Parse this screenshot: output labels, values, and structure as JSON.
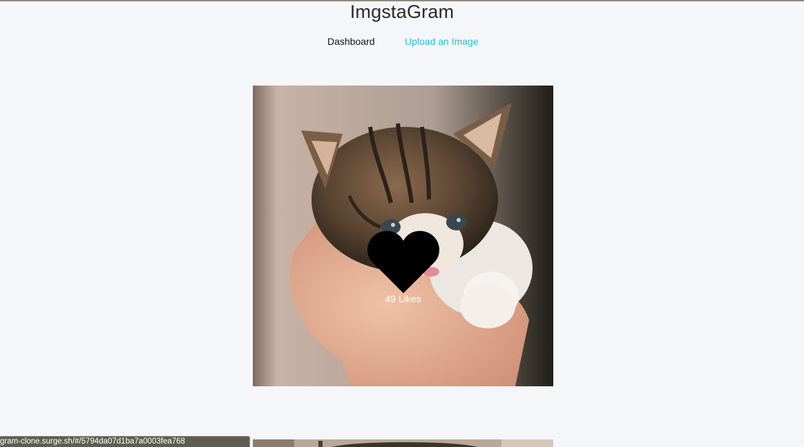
{
  "app": {
    "title": "ImgstaGram"
  },
  "nav": {
    "items": [
      {
        "label": "Dashboard",
        "active": true
      },
      {
        "label": "Upload an Image",
        "active": false
      }
    ],
    "accent_color": "#2bbdd1"
  },
  "feed": {
    "posts": [
      {
        "image_subject": "kitten held in a hand",
        "likes_label": "49 Likes",
        "likes": 49,
        "like_icon": "heart-icon"
      },
      {
        "image_subject": "next post image (partially visible)"
      }
    ]
  },
  "status_bar": {
    "url": "gram-clone.surge.sh/#/5794da07d1ba7a0003fea768"
  },
  "colors": {
    "background": "#f5f6f9",
    "heart": "#000000"
  }
}
